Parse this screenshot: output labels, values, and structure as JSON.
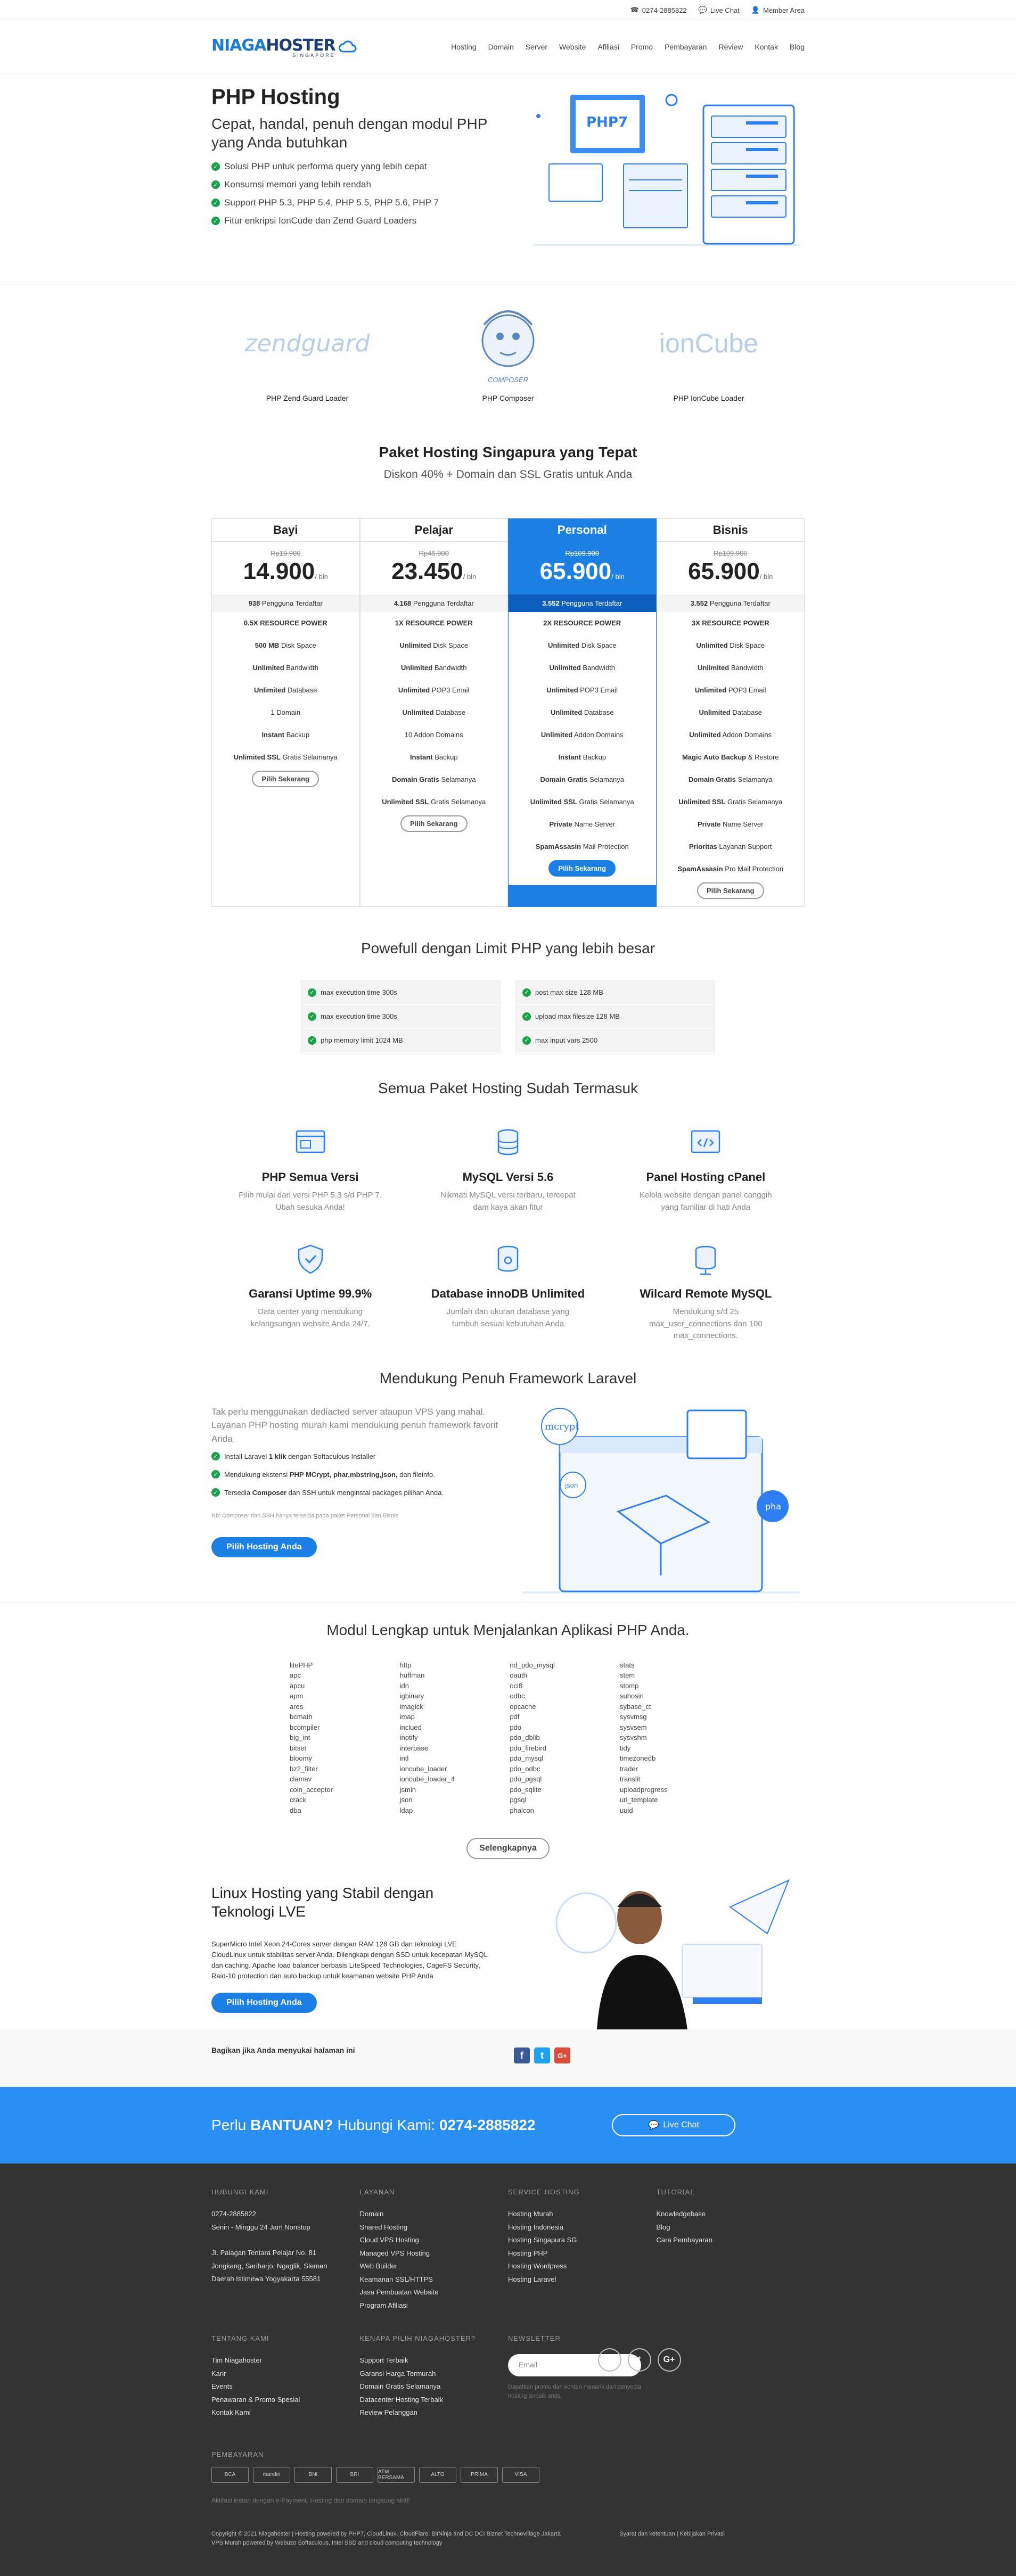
{
  "topbar": {
    "phone": "0274-2885822",
    "livechat": "Live Chat",
    "member": "Member Area"
  },
  "logo": {
    "brand_a": "NIAGA",
    "brand_b": "HOSTER",
    "tagline": "SINGAPORE"
  },
  "nav": [
    "Hosting",
    "Domain",
    "Server",
    "Website",
    "Afiliasi",
    "Promo",
    "Pembayaran",
    "Review",
    "Kontak",
    "Blog"
  ],
  "hero": {
    "title": "PHP Hosting",
    "subtitle": "Cepat, handal, penuh dengan modul PHP yang Anda butuhkan",
    "points": [
      "Solusi PHP untuk performa query yang lebih cepat",
      "Konsumsi memori yang lebih rendah",
      "Support PHP 5.3, PHP 5.4, PHP 5.5, PHP 5.6, PHP 7",
      "Fitur enkripsi IonCude dan Zend Guard Loaders"
    ],
    "illustration_label": "PHP7"
  },
  "tools": [
    {
      "logo": "zendguard",
      "caption": "PHP Zend Guard Loader"
    },
    {
      "logo": "COMPOSER",
      "caption": "PHP Composer"
    },
    {
      "logo": "ionCube",
      "caption": "PHP IonCube Loader"
    }
  ],
  "pricing": {
    "title": "Paket Hosting Singapura yang Tepat",
    "subtitle": "Diskon 40% + Domain dan SSL Gratis untuk Anda",
    "per": "/ bln",
    "plans": [
      {
        "name": "Bayi",
        "old": "Rp19.900",
        "price": "14.900",
        "users_n": "938",
        "users_t": " Pengguna Terdaftar",
        "features": [
          [
            "",
            "0.5X RESOURCE POWER"
          ],
          [
            "500 MB",
            "Disk Space"
          ],
          [
            "Unlimited",
            "Bandwidth"
          ],
          [
            "Unlimited",
            "Database"
          ],
          [
            "",
            "1 Domain"
          ],
          [
            "Instant",
            "Backup"
          ],
          [
            "Unlimited SSL",
            "Gratis Selamanya"
          ]
        ],
        "button": "Pilih Sekarang"
      },
      {
        "name": "Pelajar",
        "old": "Rp46.900",
        "price": "23.450",
        "users_n": "4.168",
        "users_t": " Pengguna Terdaftar",
        "features": [
          [
            "",
            "1X RESOURCE POWER"
          ],
          [
            "Unlimited",
            "Disk Space"
          ],
          [
            "Unlimited",
            "Bandwidth"
          ],
          [
            "Unlimited",
            "POP3 Email"
          ],
          [
            "Unlimited",
            "Database"
          ],
          [
            "",
            "10 Addon Domains"
          ],
          [
            "Instant",
            "Backup"
          ],
          [
            "Domain Gratis",
            "Selamanya"
          ],
          [
            "Unlimited SSL",
            "Gratis Selamanya"
          ]
        ],
        "button": "Pilih Sekarang"
      },
      {
        "name": "Personal",
        "old": "Rp109.900",
        "price": "65.900",
        "users_n": "3.552",
        "users_t": " Pengguna Terdaftar",
        "features": [
          [
            "",
            "2X RESOURCE POWER"
          ],
          [
            "Unlimited",
            "Disk Space"
          ],
          [
            "Unlimited",
            "Bandwidth"
          ],
          [
            "Unlimited",
            "POP3 Email"
          ],
          [
            "Unlimited",
            "Database"
          ],
          [
            "Unlimited",
            "Addon Domains"
          ],
          [
            "Instant",
            "Backup"
          ],
          [
            "Domain Gratis",
            "Selamanya"
          ],
          [
            "Unlimited SSL",
            "Gratis Selamanya"
          ],
          [
            "Private",
            "Name Server"
          ],
          [
            "SpamAssasin",
            "Mail Protection"
          ]
        ],
        "button": "Pilih Sekarang"
      },
      {
        "name": "Bisnis",
        "old": "Rp109.900",
        "price": "65.900",
        "users_n": "3.552",
        "users_t": " Pengguna Terdaftar",
        "features": [
          [
            "",
            "3X RESOURCE POWER"
          ],
          [
            "Unlimited",
            "Disk Space"
          ],
          [
            "Unlimited",
            "Bandwidth"
          ],
          [
            "Unlimited",
            "POP3 Email"
          ],
          [
            "Unlimited",
            "Database"
          ],
          [
            "Unlimited",
            "Addon Domains"
          ],
          [
            "Magic Auto Backup",
            "& Restore"
          ],
          [
            "Domain Gratis",
            "Selamanya"
          ],
          [
            "Unlimited SSL",
            "Gratis Selamanya"
          ],
          [
            "Private",
            "Name Server"
          ],
          [
            "Prioritas",
            "Layanan Support"
          ],
          [
            "SpamAssasin",
            "Pro Mail Protection"
          ]
        ],
        "button": "Pilih Sekarang"
      }
    ]
  },
  "limits": {
    "title": "Powefull dengan Limit PHP yang lebih besar",
    "left": [
      "max execution time 300s",
      "max execution time 300s",
      "php memory limit 1024 MB"
    ],
    "right": [
      "post max size 128 MB",
      "upload max filesize 128 MB",
      "max input vars 2500"
    ]
  },
  "features": {
    "title": "Semua Paket Hosting Sudah Termasuk",
    "items": [
      {
        "icon": "browser-icon",
        "title": "PHP Semua Versi",
        "text": "Pilih mulai dari versi PHP 5.3 s/d PHP 7. Ubah sesuka Anda!"
      },
      {
        "icon": "database-icon",
        "title": "MySQL Versi 5.6",
        "text": "Nikmati MySQL versi terbaru, tercepat dam kaya akan fitur"
      },
      {
        "icon": "code-window-icon",
        "title": "Panel Hosting cPanel",
        "text": "Kelola website dengan panel canggih yang familiar di hati Anda"
      },
      {
        "icon": "shield-icon",
        "title": "Garansi Uptime 99.9%",
        "text": "Data center yang mendukung kelangsungan website Anda 24/7."
      },
      {
        "icon": "database-gear-icon",
        "title": "Database innoDB Unlimited",
        "text": "Jumlah dan ukuran database yang tumbuh sesuai kebutuhan Anda"
      },
      {
        "icon": "database-remote-icon",
        "title": "Wilcard Remote MySQL",
        "text": "Mendukung s/d 25 max_user_connections dan 100 max_connections."
      }
    ]
  },
  "laravel": {
    "title": "Mendukung Penuh Framework Laravel",
    "text": "Tak perlu menggunakan dediacted server ataupun VPS yang mahal. Layanan PHP hosting murah kami mendukung penuh framework favorit Anda",
    "points": [
      [
        "Install Laravel ",
        "1 klik",
        " dengan Softaculous Installer"
      ],
      [
        "Mendukung ekstensi ",
        "PHP MCrypt, phar,mbstring,json,",
        " dan fileinfo."
      ],
      [
        "Tersedia ",
        "Composer",
        " dan SSH untuk menginstal packages pilihan Anda."
      ]
    ],
    "note": "Nb: Composer dan SSH hanya tersedia pada paket Personal dan Bisnis",
    "button": "Pilih Hosting Anda",
    "bubbles": [
      "mcrypt",
      "json",
      "pha"
    ]
  },
  "modules": {
    "title": "Modul Lengkap untuk Menjalankan Aplikasi PHP Anda.",
    "cols": [
      [
        "litePHP",
        "apc",
        "apcu",
        "apm",
        "ares",
        "bcmath",
        "bcompiler",
        "big_int",
        "bitset",
        "bloomy",
        "bz2_filter",
        "clamav",
        "coin_acceptor",
        "crack",
        "dba"
      ],
      [
        "http",
        "huffman",
        "idn",
        "igbinary",
        "imagick",
        "imap",
        "inclued",
        "inotify",
        "interbase",
        "intl",
        "ioncube_loader",
        "ioncube_loader_4",
        "jsmin",
        "json",
        "ldap"
      ],
      [
        "nd_pdo_mysql",
        "oauth",
        "oci8",
        "odbc",
        "opcache",
        "pdf",
        "pdo",
        "pdo_dblib",
        "pdo_firebird",
        "pdo_mysql",
        "pdo_odbc",
        "pdo_pgsql",
        "pdo_sqlite",
        "pgsql",
        "phalcon"
      ],
      [
        "stats",
        "stem",
        "stomp",
        "suhosin",
        "sybase_ct",
        "sysvmsg",
        "sysvsem",
        "sysvshm",
        "tidy",
        "timezonedb",
        "trader",
        "translit",
        "uploadprogress",
        "uri_template",
        "uuid"
      ]
    ],
    "button": "Selengkapnya"
  },
  "linux": {
    "title": "Linux Hosting yang Stabil dengan Teknologi LVE",
    "text": "SuperMicro Intel Xeon 24-Cores server dengan RAM 128 GB dan teknologi LVE CloudLinux untuk stabilitas server Anda. Dilengkapi dengan SSD untuk kecepatan MySQL dan caching. Apache load balancer berbasis LiteSpeed Technologies, CageFS Security, Raid-10 protection dan auto backup untuk keamanan website PHP Anda",
    "button": "Pilih Hosting Anda"
  },
  "share": {
    "label": "Bagikan jika Anda menyukai halaman ini"
  },
  "help": {
    "pre": "Perlu ",
    "bold": "BANTUAN?",
    "mid": " Hubungi Kami: ",
    "phone": "0274-2885822",
    "button": "Live Chat"
  },
  "footer": {
    "cols": [
      {
        "title": "HUBUNGI KAMI",
        "lines": [
          "0274-2885822",
          "Senin - Minggu 24 Jam Nonstop",
          "",
          "Jl. Palagan Tentara Pelajar No. 81",
          "Jongkang, Sariharjo, Ngaglik, Sleman",
          "Daerah Istimewa Yogyakarta 55581"
        ]
      },
      {
        "title": "LAYANAN",
        "lines": [
          "Domain",
          "Shared Hosting",
          "Cloud VPS Hosting",
          "Managed VPS Hosting",
          "Web Builder",
          "Keamanan SSL/HTTPS",
          "Jasa Pembuatan Website",
          "Program Afiliasi"
        ]
      },
      {
        "title": "SERVICE HOSTING",
        "lines": [
          "Hosting Murah",
          "Hosting Indonesia",
          "Hosting Singapura SG",
          "Hosting PHP",
          "Hosting Wordpress",
          "Hosting Laravel"
        ]
      },
      {
        "title": "TUTORIAL",
        "lines": [
          "Knowledgebase",
          "Blog",
          "Cara Pembayaran"
        ]
      }
    ],
    "cols2": [
      {
        "title": "TENTANG KAMI",
        "lines": [
          "Tim Niagahoster",
          "Karir",
          "Events",
          "Penawaran & Promo Spesial",
          "Kontak Kami"
        ]
      },
      {
        "title": "KENAPA PILIH NIAGAHOSTER?",
        "lines": [
          "Support Terbaik",
          "Garansi Harga Termurah",
          "Domain Gratis Selamanya",
          "Datacenter Hosting Terbaik",
          "Review Pelanggan"
        ]
      }
    ],
    "newsletter": {
      "title": "NEWSLETTER",
      "placeholder": "Email",
      "note": "Dapatkan promo dan konten menarik dari penyedia hosting terbaik anda"
    },
    "payment_label": "PEMBAYARAN",
    "payments": [
      "BCA",
      "mandiri",
      "BNI",
      "BRI",
      "ATM BERSAMA",
      "ALTO",
      "PRIMA",
      "VISA"
    ],
    "note": "Aktifasi instan dengan e-Payment. Hosting dan domain langsung aktif!",
    "copy1": "Copyright © 2021 Niagahoster | Hosting powered by PHP7, CloudLinux, CloudFlare, BitNinja and DC DCI Biznet Technovillage Jakarta",
    "copy2": "VPS Murah powered by Webuzo Softaculous, Intel SSD and cloud computing technology",
    "links": "Syarat dan ketentuan | Kebijakan Privasi"
  }
}
